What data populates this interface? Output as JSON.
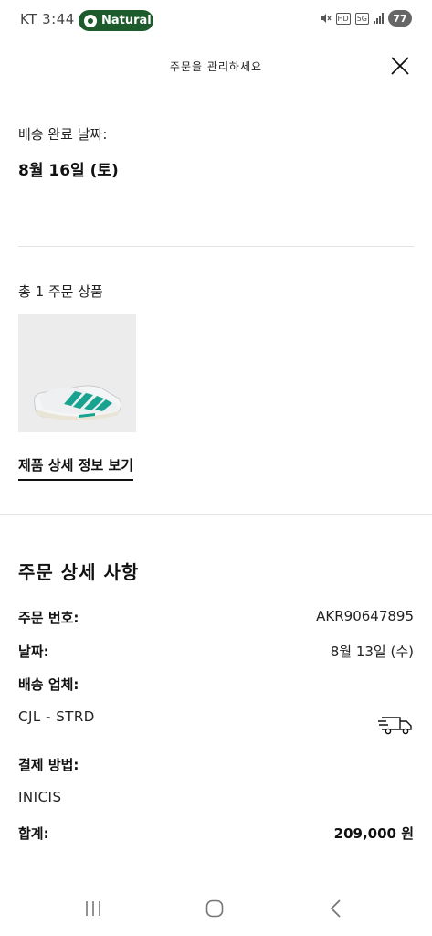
{
  "status_bar": {
    "carrier_time": "KT 3:44",
    "mode_label": "Natural",
    "hd_label": "HD",
    "network_label": "5G",
    "battery": "77"
  },
  "header": {
    "title": "주문을 관리하세요"
  },
  "delivery": {
    "label": "배송 완료 날짜:",
    "date": "8월 16일 (토)"
  },
  "products": {
    "count_label": "총 1 주문 상품",
    "view_details": "제품 상세 정보 보기"
  },
  "order_details": {
    "title": "주문 상세 사항",
    "order_number_label": "주문 번호:",
    "order_number": "AKR90647895",
    "date_label": "날짜:",
    "date": "8월 13일 (수)",
    "carrier_label": "배송 업체:",
    "carrier": "CJL - STRD",
    "payment_label": "결제 방법:",
    "payment": "INICIS",
    "total_label": "합계:",
    "total": "209,000 원"
  },
  "colors": {
    "mode_pill": "#1e5b2c",
    "shoe_accent": "#17a38f"
  },
  "icons": [
    "close-icon",
    "truck-icon",
    "nav-recents-icon",
    "nav-home-icon",
    "nav-back-icon"
  ]
}
